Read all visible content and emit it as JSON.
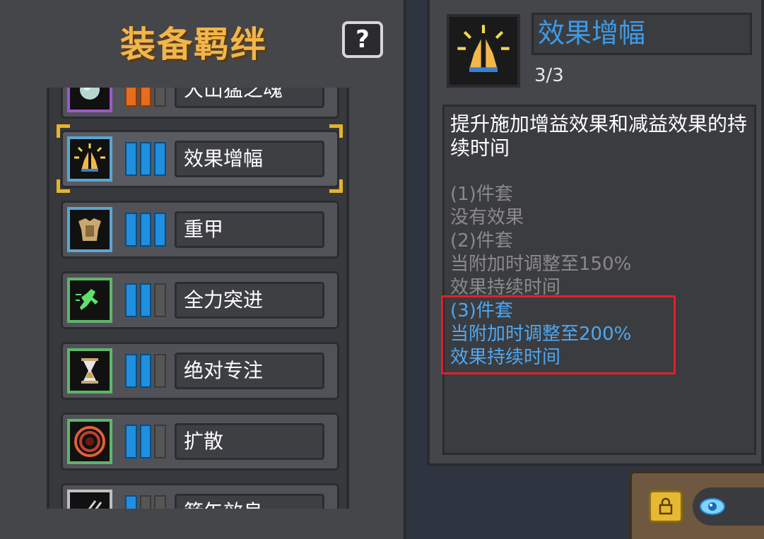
{
  "left_panel": {
    "title": "装备羁绊",
    "help_label": "?",
    "items": [
      {
        "label": "大山猛之魂",
        "icon": "orb-icon",
        "bars": [
          "orange",
          "orange",
          "gray"
        ],
        "border": "#9b59c9"
      },
      {
        "label": "效果增幅",
        "icon": "praying-hands-icon",
        "bars": [
          "blue",
          "blue",
          "blue"
        ],
        "border": "#5aa6d3",
        "selected": true
      },
      {
        "label": "重甲",
        "icon": "armor-icon",
        "bars": [
          "blue",
          "blue",
          "blue"
        ],
        "border": "#5aa6d3"
      },
      {
        "label": "全力突进",
        "icon": "dash-icon",
        "bars": [
          "blue",
          "blue",
          "gray"
        ],
        "border": "#5fb56a"
      },
      {
        "label": "绝对专注",
        "icon": "hourglass-icon",
        "bars": [
          "blue",
          "blue",
          "gray"
        ],
        "border": "#5fb56a"
      },
      {
        "label": "扩散",
        "icon": "ripple-icon",
        "bars": [
          "blue",
          "blue",
          "gray"
        ],
        "border": "#5fb56a"
      },
      {
        "label": "箭矢效良",
        "icon": "arrows-icon",
        "bars": [
          "blue",
          "gray",
          "gray"
        ],
        "border": "#bfbfbf"
      }
    ]
  },
  "detail": {
    "name": "效果增幅",
    "count": "3/3",
    "icon": "praying-hands-icon",
    "description": "提升施加增益效果和减益效果的持续时间",
    "tiers": [
      {
        "lines": [
          "(1)件套",
          "没有效果"
        ],
        "active": false
      },
      {
        "lines": [
          "(2)件套",
          "当附加时调整至150%",
          "效果持续时间"
        ],
        "active": false
      },
      {
        "lines": [
          "(3)件套",
          "当附加时调整至200%",
          "效果持续时间"
        ],
        "active": true
      }
    ]
  },
  "colors": {
    "title": "#f2b54a",
    "active_tier": "#4ea7f2",
    "inactive_tier": "#8a8a8a",
    "highlight": "#e2202a"
  }
}
